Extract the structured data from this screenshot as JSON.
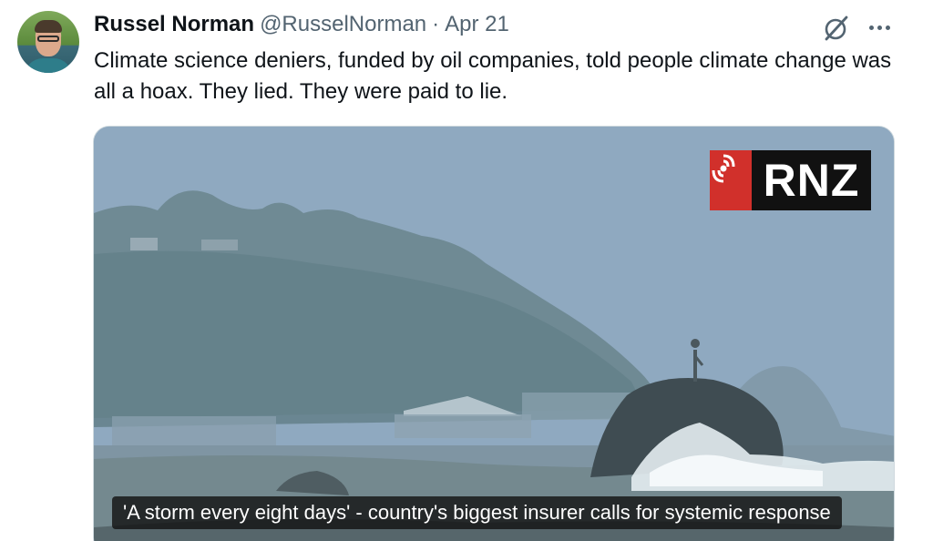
{
  "tweet": {
    "author_name": "Russel Norman",
    "handle": "@RusselNorman",
    "separator": "·",
    "date": "Apr 21",
    "text": "Climate science deniers, funded by oil companies, told people climate change was all a hoax. They lied. They were paid to lie.",
    "icons": {
      "grok": "grok-icon",
      "more": "more-options-icon"
    }
  },
  "media": {
    "logo_text": "RNZ",
    "caption": "'A storm every eight days' - country's biggest insurer calls for systemic response",
    "colors": {
      "logo_red": "#d1302b",
      "logo_black": "#111111"
    }
  }
}
